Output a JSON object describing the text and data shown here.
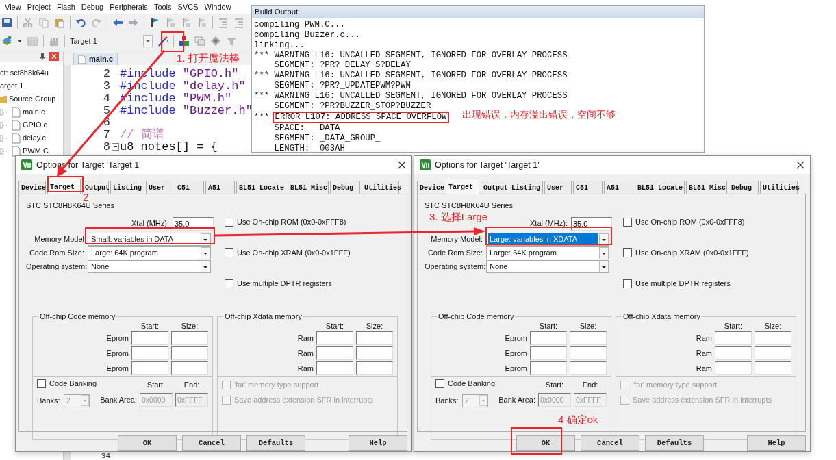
{
  "ide": {
    "menu": [
      {
        "label": "View"
      },
      {
        "label": "Project"
      },
      {
        "label": "Flash"
      },
      {
        "label": "Debug"
      },
      {
        "label": "Peripherals"
      },
      {
        "label": "Tools"
      },
      {
        "label": "SVCS"
      },
      {
        "label": "Window"
      }
    ],
    "toolbar": {
      "target": "Target 1"
    },
    "project_panel": {
      "tree": [
        {
          "label": "ct: sct8h8k64u",
          "children": [
            {
              "label": "arget 1",
              "children": [
                {
                  "label": "Source Group",
                  "children": [
                    {
                      "label": "main.c"
                    },
                    {
                      "label": "GPIO.c"
                    },
                    {
                      "label": "delay.c"
                    },
                    {
                      "label": "PWM.C"
                    }
                  ]
                }
              ]
            }
          ]
        }
      ]
    },
    "editor": {
      "tab": "main.c",
      "lines": [
        {
          "number": "2",
          "tokens": [
            {
              "kind": "directive",
              "text": "#include"
            },
            {
              "kind": "string",
              "text": " \"GPIO.h\""
            }
          ]
        },
        {
          "number": "3",
          "tokens": [
            {
              "kind": "directive",
              "text": "#include"
            },
            {
              "kind": "string",
              "text": " \"delay.h\""
            }
          ]
        },
        {
          "number": "4",
          "tokens": [
            {
              "kind": "directive",
              "text": "#include"
            },
            {
              "kind": "string",
              "text": " \"PWM.h\""
            }
          ]
        },
        {
          "number": "5",
          "tokens": [
            {
              "kind": "directive",
              "text": "#include"
            },
            {
              "kind": "string",
              "text": " \"Buzzer.h\""
            }
          ]
        },
        {
          "number": "6"
        },
        {
          "number": "7",
          "tokens": [
            {
              "kind": "comment",
              "text": "// 简谱"
            }
          ]
        },
        {
          "number": "8",
          "fold": true,
          "tokens": [
            {
              "kind": "plain",
              "text": "u8 notes[] = {"
            }
          ]
        }
      ],
      "bottom_line": {
        "number": "34"
      }
    }
  },
  "build_output": {
    "title": "Build Output",
    "lines": [
      {
        "text": "compiling PWM.C..."
      },
      {
        "text": "compiling Buzzer.c..."
      },
      {
        "text": "linking..."
      },
      {
        "text": "*** WARNING L16: UNCALLED SEGMENT, IGNORED FOR OVERLAY PROCESS"
      },
      {
        "text": "    SEGMENT: ?PR?_DELAY_S?DELAY"
      },
      {
        "text": "*** WARNING L16: UNCALLED SEGMENT, IGNORED FOR OVERLAY PROCESS"
      },
      {
        "text": "    SEGMENT: ?PR?_UPDATEPWM?PWM"
      },
      {
        "text": "*** WARNING L16: UNCALLED SEGMENT, IGNORED FOR OVERLAY PROCESS"
      },
      {
        "text": "    SEGMENT: ?PR?BUZZER_STOP?BUZZER"
      },
      {
        "prefix": "***",
        "text": "ERROR L107: ADDRESS SPACE OVERFLOW",
        "highlighted": true
      },
      {
        "text": "    SPACE:   DATA"
      },
      {
        "text": "    SEGMENT: _DATA_GROUP_"
      },
      {
        "text": "    LENGTH:  003AH"
      }
    ]
  },
  "dialogs": [
    {
      "title": "Options for Target 'Target 1'",
      "tabs": [
        {
          "label": "Device",
          "selected": false
        },
        {
          "label": "Target",
          "selected": true
        },
        {
          "label": "Output",
          "selected": false
        },
        {
          "label": "Listing",
          "selected": false
        },
        {
          "label": "User",
          "selected": false
        },
        {
          "label": "C51",
          "selected": false
        },
        {
          "label": "A51",
          "selected": false
        },
        {
          "label": "BL51 Locate",
          "selected": false
        },
        {
          "label": "BL51 Misc",
          "selected": false
        },
        {
          "label": "Debug",
          "selected": false
        },
        {
          "label": "Utilities",
          "selected": false
        }
      ],
      "device": "STC STC8H8K64U Series",
      "xtal": {
        "label": "Xtal (MHz):",
        "value": "35.0"
      },
      "selects": [
        {
          "label": "Memory Model",
          "value": "Small: variables in DATA",
          "highlighted": false
        },
        {
          "label": "Code Rom Size:",
          "value": "Large: 64K program",
          "highlighted": false
        },
        {
          "label": "Operating system:",
          "value": "None",
          "highlighted": false
        }
      ],
      "options": [
        {
          "label": "Use On-chip ROM (0x0-0xFFF8)",
          "checked": false
        },
        {
          "label": "Use On-chip XRAM (0x0-0x1FFF)",
          "checked": false
        },
        {
          "label": "Use multiple DPTR registers",
          "checked": false
        }
      ],
      "code_memory": {
        "title": "Off-chip Code memory",
        "headers": [
          "Start:",
          "Size:"
        ],
        "rows": [
          {
            "label": "Eprom"
          },
          {
            "label": "Eprom"
          },
          {
            "label": "Eprom"
          }
        ]
      },
      "xdata_memory": {
        "title": "Off-chip Xdata memory",
        "headers": [
          "Start:",
          "Size:"
        ],
        "rows": [
          {
            "label": "Ram"
          },
          {
            "label": "Ram"
          },
          {
            "label": "Ram"
          }
        ]
      },
      "banking": {
        "label": "Code Banking",
        "checked": false,
        "disabled": true,
        "banks_label": "Banks:",
        "banks": "2",
        "headers": [
          "Start:",
          "End:"
        ],
        "area_label": "Bank Area:",
        "start": "0x0000",
        "end": "0xFFFF"
      },
      "far_options": [
        {
          "label": "'far' memory type support",
          "checked": false,
          "disabled": true
        },
        {
          "label": "Save address extension SFR in interrupts",
          "checked": false,
          "disabled": true
        }
      ],
      "buttons": [
        {
          "label": "OK"
        },
        {
          "label": "Cancel"
        },
        {
          "label": "Defaults"
        },
        {
          "label": "Help"
        }
      ]
    },
    {
      "title": "Options for Target 'Target 1'",
      "tabs": [
        {
          "label": "Device",
          "selected": false
        },
        {
          "label": "Target",
          "selected": true
        },
        {
          "label": "Output",
          "selected": false
        },
        {
          "label": "Listing",
          "selected": false
        },
        {
          "label": "User",
          "selected": false
        },
        {
          "label": "C51",
          "selected": false
        },
        {
          "label": "A51",
          "selected": false
        },
        {
          "label": "BL51 Locate",
          "selected": false
        },
        {
          "label": "BL51 Misc",
          "selected": false
        },
        {
          "label": "Debug",
          "selected": false
        },
        {
          "label": "Utilities",
          "selected": false
        }
      ],
      "device": "STC STC8H8K64U Series",
      "xtal": {
        "label": "Xtal (MHz):",
        "value": "35.0"
      },
      "selects": [
        {
          "label": "Memory Model:",
          "value": "Large: variables in XDATA",
          "highlighted": true
        },
        {
          "label": "Code Rom Size:",
          "value": "Large: 64K program",
          "highlighted": false
        },
        {
          "label": "Operating system:",
          "value": "None",
          "highlighted": false
        }
      ],
      "options": [
        {
          "label": "Use On-chip ROM (0x0-0xFFF8)",
          "checked": false
        },
        {
          "label": "Use On-chip XRAM (0x0-0x1FFF)",
          "checked": false
        },
        {
          "label": "Use multiple DPTR registers",
          "checked": false
        }
      ],
      "code_memory": {
        "title": "Off-chip Code memory",
        "headers": [
          "Start:",
          "Size:"
        ],
        "rows": [
          {
            "label": "Eprom"
          },
          {
            "label": "Eprom"
          },
          {
            "label": "Eprom"
          }
        ]
      },
      "xdata_memory": {
        "title": "Off-chip Xdata memory",
        "headers": [
          "Start:",
          "Size:"
        ],
        "rows": [
          {
            "label": "Ram"
          },
          {
            "label": "Ram"
          },
          {
            "label": "Ram"
          }
        ]
      },
      "banking": {
        "label": "Code Banking",
        "checked": false,
        "disabled": true,
        "banks_label": "Banks:",
        "banks": "2",
        "headers": [
          "Start:",
          "End:"
        ],
        "area_label": "Bank Area:",
        "start": "0x0000",
        "end": "0xFFFF"
      },
      "far_options": [
        {
          "label": "'far' memory type support",
          "checked": false,
          "disabled": true
        },
        {
          "label": "Save address extension SFR in interrupts",
          "checked": false,
          "disabled": true
        }
      ],
      "buttons": [
        {
          "label": "OK"
        },
        {
          "label": "Cancel"
        },
        {
          "label": "Defaults"
        },
        {
          "label": "Help"
        }
      ]
    }
  ],
  "annotations": [
    {
      "kind": "step",
      "text": "1. 打开魔法棒"
    },
    {
      "kind": "step",
      "text": "2"
    },
    {
      "kind": "note",
      "text": "出现错误，内存溢出错误，空间不够"
    },
    {
      "kind": "step",
      "text": "3. 选择Large"
    },
    {
      "kind": "step",
      "text": "4 确定ok"
    }
  ]
}
